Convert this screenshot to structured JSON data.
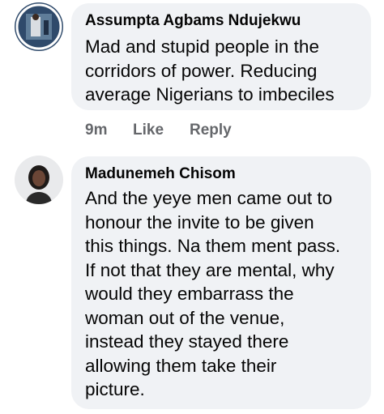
{
  "comments": [
    {
      "author": "Assumpta Agbams Ndujekwu",
      "text_lines": [
        "Mad and stupid people in the",
        "corridors of power. Reducing",
        "average Nigerians to imbeciles"
      ],
      "time": "9m",
      "like_label": "Like",
      "reply_label": "Reply"
    },
    {
      "author": "Madunemeh Chisom",
      "text_lines": [
        "And the yeye men came out to",
        "honour the invite to be given",
        "this things. Na them ment pass.",
        "If not that they are mental, why",
        "would they embarrass the",
        "woman out of the venue,",
        "instead they stayed there",
        "allowing them take their",
        "picture."
      ]
    }
  ],
  "colors": {
    "bubble": "#f0f2f5",
    "text": "#050505",
    "secondary_text": "#65676b"
  }
}
